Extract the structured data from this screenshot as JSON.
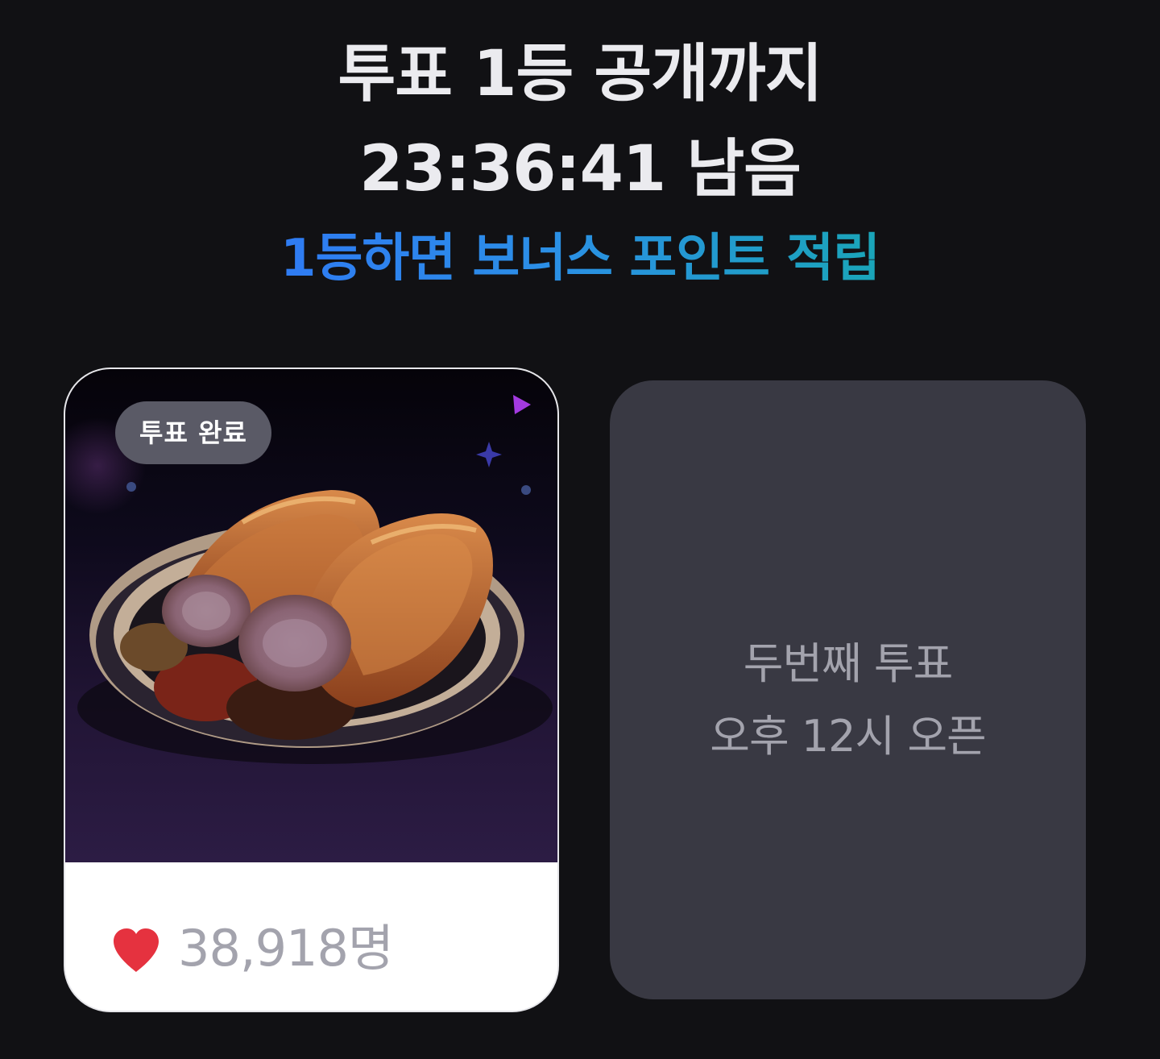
{
  "header": {
    "line1": "투표 1등 공개까지",
    "line2": "23:36:41 남음",
    "subtitle": "1등하면 보너스 포인트 적립",
    "subtitle_gradient": [
      "#2f7bf3",
      "#1aa5b8"
    ]
  },
  "vote_card": {
    "badge": "투표 완료",
    "count": "38,918명",
    "icon": "heart-icon",
    "image": "braised-pork-trotters-plate"
  },
  "next_card": {
    "line1": "두번째 투표",
    "line2": "오후 12시 오픈"
  },
  "colors": {
    "background": "#111114",
    "heart": "#e5323f",
    "muted_text": "#a3a3ad",
    "locked_card": "#393943"
  }
}
